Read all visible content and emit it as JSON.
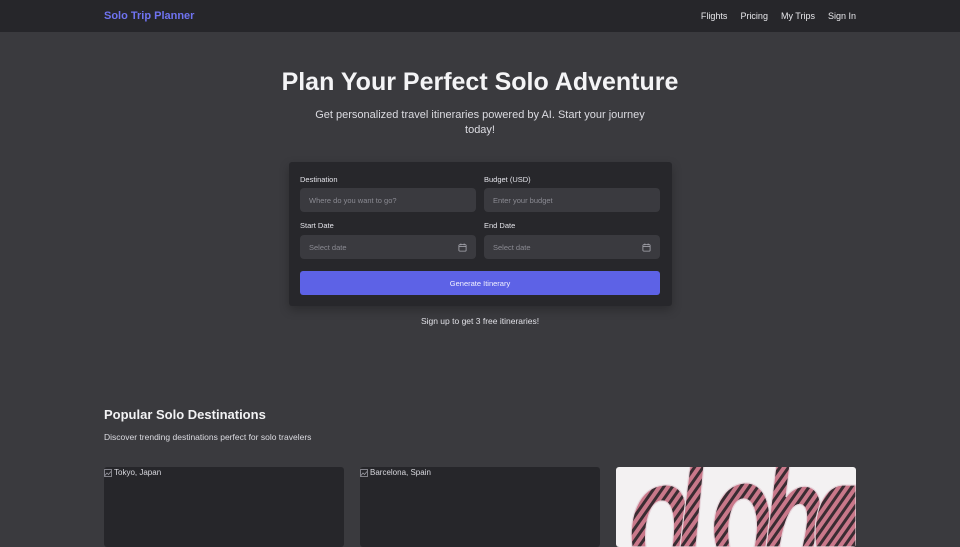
{
  "header": {
    "brand": "Solo Trip Planner",
    "nav": [
      "Flights",
      "Pricing",
      "My Trips",
      "Sign In"
    ]
  },
  "hero": {
    "title": "Plan Your Perfect Solo Adventure",
    "subtitle": "Get personalized travel itineraries powered by AI. Start your journey today!"
  },
  "form": {
    "destination_label": "Destination",
    "destination_placeholder": "Where do you want to go?",
    "budget_label": "Budget (USD)",
    "budget_placeholder": "Enter your budget",
    "start_label": "Start Date",
    "start_placeholder": "Select date",
    "end_label": "End Date",
    "end_placeholder": "Select date",
    "button": "Generate Itinerary",
    "note": "Sign up to get 3 free itineraries!"
  },
  "popular": {
    "title": "Popular Solo Destinations",
    "subtitle": "Discover trending destinations perfect for solo travelers",
    "cards": [
      {
        "alt": "Tokyo, Japan"
      },
      {
        "alt": "Barcelona, Spain"
      },
      {
        "alt": ""
      }
    ]
  },
  "colors": {
    "accent": "#5d62e6",
    "brand": "#6f73f0",
    "background": "#3a3a3e",
    "header": "#26262a"
  }
}
